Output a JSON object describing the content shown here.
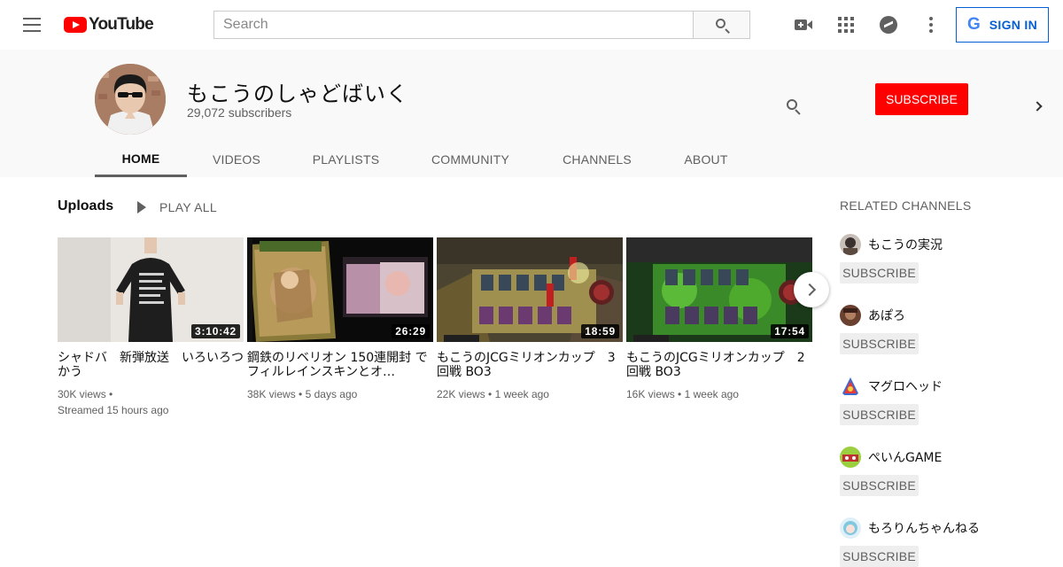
{
  "masthead": {
    "logo_text": "YouTube",
    "search_placeholder": "Search",
    "signin_g": "G",
    "signin_label": "SIGN IN",
    "icons": [
      "menu-icon",
      "video-camera-icon",
      "apps-grid-icon",
      "messages-icon",
      "more-vert-icon",
      "search-icon"
    ]
  },
  "channel": {
    "name": "もこうのしゃどばいく",
    "subscribers": "29,072 subscribers",
    "subscribe_label": "SUBSCRIBE"
  },
  "tabs": [
    {
      "label": "HOME",
      "active": true
    },
    {
      "label": "VIDEOS"
    },
    {
      "label": "PLAYLISTS"
    },
    {
      "label": "COMMUNITY"
    },
    {
      "label": "CHANNELS"
    },
    {
      "label": "ABOUT"
    }
  ],
  "uploads": {
    "title": "Uploads",
    "play_all": "PLAY ALL",
    "videos": [
      {
        "title": "シャドバ　新弾放送　いろいろつかう",
        "duration": "3:10:42",
        "views": "30K views",
        "sep": "•",
        "age": "Streamed 15 hours ago"
      },
      {
        "title": "鋼鉄のリベリオン 150連開封 でフィルレインスキンとオ…",
        "duration": "26:29",
        "views": "38K views",
        "sep": "•",
        "age": "5 days ago"
      },
      {
        "title": "もこうのJCGミリオンカップ　3回戦 BO3",
        "duration": "18:59",
        "views": "22K views",
        "sep": "•",
        "age": "1 week ago"
      },
      {
        "title": "もこうのJCGミリオンカップ　2回戦 BO3",
        "duration": "17:54",
        "views": "16K views",
        "sep": "•",
        "age": "1 week ago"
      }
    ]
  },
  "related": {
    "title": "RELATED CHANNELS",
    "subscribe_label": "SUBSCRIBE",
    "channels": [
      {
        "name": "もこうの実況"
      },
      {
        "name": "あぽろ"
      },
      {
        "name": "マグロヘッド"
      },
      {
        "name": "ぺいんGAME"
      },
      {
        "name": "もろりんちゃんねる"
      }
    ]
  },
  "colors": {
    "brand_red": "#ff0000",
    "link_blue": "#065fd4",
    "header_bg": "#f9f9f9",
    "secondary_text": "#606060"
  }
}
